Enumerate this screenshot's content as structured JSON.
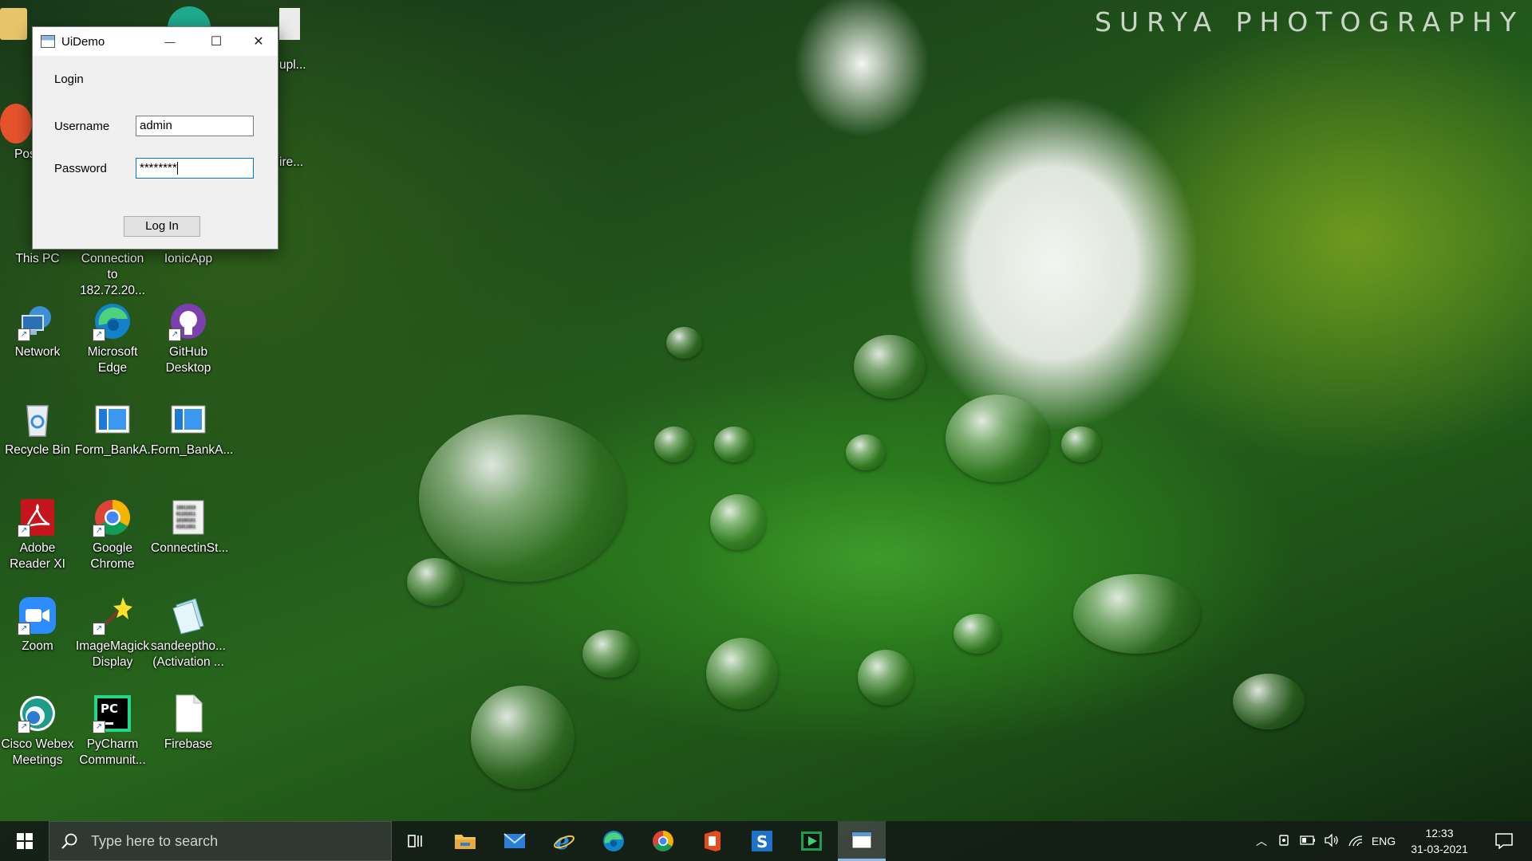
{
  "watermark": "SURYA PHOTOGRAPHY",
  "desktop": {
    "icons": [
      {
        "label1": "This PC",
        "label2": ""
      },
      {
        "label1": "Connection",
        "label2": "to 182.72.20..."
      },
      {
        "label1": "IonicApp",
        "label2": ""
      },
      {
        "label1": "Network",
        "label2": ""
      },
      {
        "label1": "Microsoft",
        "label2": "Edge"
      },
      {
        "label1": "GitHub",
        "label2": "Desktop"
      },
      {
        "label1": "Recycle Bin",
        "label2": ""
      },
      {
        "label1": "Form_BankA...",
        "label2": ""
      },
      {
        "label1": "Form_BankA...",
        "label2": ""
      },
      {
        "label1": "Adobe",
        "label2": "Reader XI"
      },
      {
        "label1": "Google",
        "label2": "Chrome"
      },
      {
        "label1": "ConnectinSt...",
        "label2": ""
      },
      {
        "label1": "Zoom",
        "label2": ""
      },
      {
        "label1": "ImageMagick",
        "label2": "Display"
      },
      {
        "label1": "sandeeptho...",
        "label2": "(Activation ..."
      },
      {
        "label1": "Cisco Webex",
        "label2": "Meetings"
      },
      {
        "label1": "PyCharm",
        "label2": "Communit..."
      },
      {
        "label1": "Firebase",
        "label2": ""
      }
    ],
    "partial": [
      "Pos",
      "upl...",
      "ire..."
    ]
  },
  "window": {
    "title": "UiDemo",
    "heading": "Login",
    "username_label": "Username",
    "username_value": "admin",
    "password_label": "Password",
    "password_value": "********",
    "login_button": "Log In",
    "minimize": "—",
    "maximize": "☐",
    "close": "✕"
  },
  "taskbar": {
    "search_placeholder": "Type here to search",
    "pinned": [
      "task-view",
      "file-explorer",
      "mail",
      "internet-explorer",
      "microsoft-edge",
      "google-chrome",
      "office",
      "app-s",
      "media-player",
      "uidemo"
    ],
    "language": "ENG",
    "time": "12:33",
    "date": "31-03-2021"
  }
}
